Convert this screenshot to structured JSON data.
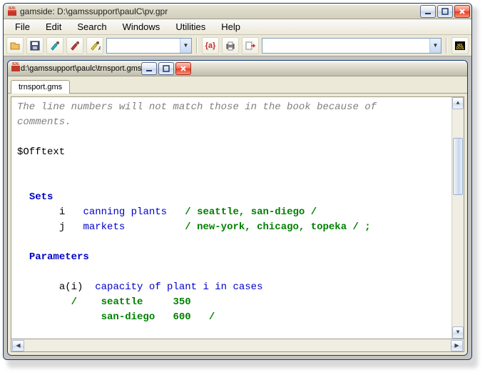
{
  "window": {
    "app_label": "gamside",
    "project_path": "D:\\gamssupport\\paulC\\pv.gpr",
    "icon_text": "IDE"
  },
  "menubar": {
    "file": "File",
    "edit": "Edit",
    "search": "Search",
    "windows": "Windows",
    "utilities": "Utilities",
    "help": "Help"
  },
  "toolbar": {
    "a_label": "{a}",
    "dropdown1_value": "",
    "dropdown2_value": ""
  },
  "child_window": {
    "title": "d:\\gamssupport\\paulc\\trnsport.gms",
    "icon_text": "IDE",
    "tab": "trnsport.gms"
  },
  "editor": {
    "line_comment": "The line numbers will not match those in the book because of",
    "line_comment2": "comments.",
    "line_offtext": "$Offtext",
    "kw_sets": "Sets",
    "set_i_name": "i",
    "set_i_desc": "canning plants",
    "set_i_data": "/ seattle, san-diego /",
    "set_j_name": "j",
    "set_j_desc": "markets",
    "set_j_data": "/ new-york, chicago, topeka / ;",
    "kw_params": "Parameters",
    "param_a": "a(i)",
    "param_a_desc": "capacity of plant i in cases",
    "param_slash1": "/",
    "param_seattle": "seattle     350",
    "param_sandiego": "san-diego   600",
    "param_slash2": "/"
  }
}
